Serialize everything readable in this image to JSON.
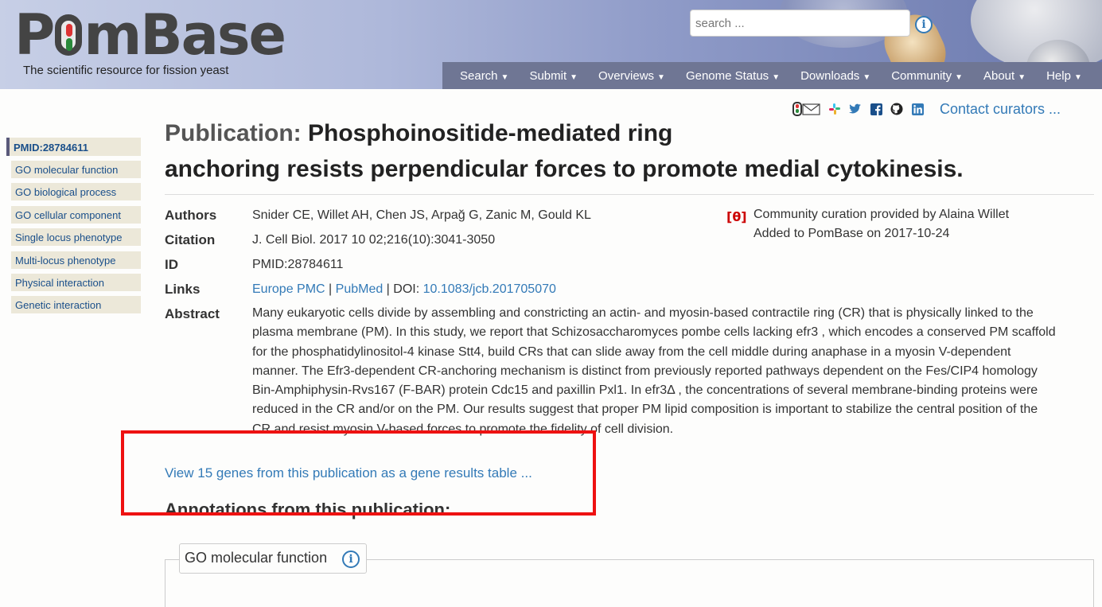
{
  "header": {
    "logo_text_left": "P",
    "logo_text_right": "mBase",
    "tagline": "The scientific resource for fission yeast",
    "search_placeholder": "search ...",
    "info_icon": "info-circle-icon",
    "nav": [
      "Search",
      "Submit",
      "Overviews",
      "Genome Status",
      "Downloads",
      "Community",
      "About",
      "Help"
    ]
  },
  "social": {
    "icons": [
      "pombase-mail-icon",
      "slack-icon",
      "twitter-icon",
      "facebook-icon",
      "github-icon",
      "linkedin-icon"
    ],
    "contact": "Contact curators ..."
  },
  "sidebar": {
    "title": "PMID:28784611",
    "items": [
      "GO molecular function",
      "GO biological process",
      "GO cellular component",
      "Single locus phenotype",
      "Multi-locus phenotype",
      "Physical interaction",
      "Genetic interaction"
    ]
  },
  "publication": {
    "title_label": "Publication: ",
    "title_line1": "Phosphoinositide-mediated ring",
    "title_line2": "anchoring resists perpendicular forces to promote medial cytokinesis.",
    "labels": {
      "authors": "Authors",
      "citation": "Citation",
      "id": "ID",
      "links": "Links",
      "abstract": "Abstract"
    },
    "authors": "Snider CE, Willet AH, Chen JS, Arpağ G, Zanic M, Gould KL",
    "citation": "J. Cell Biol. 2017 10 02;216(10):3041-3050",
    "id": "PMID:28784611",
    "links": {
      "europe_pmc": "Europe PMC",
      "sep1": " | ",
      "pubmed": "PubMed",
      "sep2": " | DOI: ",
      "doi": "10.1083/jcb.201705070"
    },
    "abstract": "Many eukaryotic cells divide by assembling and constricting an actin- and myosin-based contractile ring (CR) that is physically linked to the plasma membrane (PM). In this study, we report that Schizosaccharomyces pombe cells lacking efr3 , which encodes a conserved PM scaffold for the phosphatidylinositol-4 kinase Stt4, build CRs that can slide away from the cell middle during anaphase in a myosin V-dependent manner. The Efr3-dependent CR-anchoring mechanism is distinct from previously reported pathways dependent on the Fes/CIP4 homology Bin-Amphiphysin-Rvs167 (F-BAR) protein Cdc15 and paxillin Pxl1. In efr3Δ , the concentrations of several membrane-binding proteins were reduced in the CR and/or on the PM. Our results suggest that proper PM lipid composition is important to stabilize the central position of the CR and resist myosin V-based forces to promote the fidelity of cell division.",
    "curation_badge": "[θ]",
    "curation_line1": "Community curation provided by Alaina Willet",
    "curation_line2": "Added to PomBase on 2017-10-24"
  },
  "genes_link": "View 15 genes from this publication as a gene results table ...",
  "annotations_heading": "Annotations from this publication:",
  "panel_title": "GO molecular function",
  "colors": {
    "link": "#337ab7",
    "navbar": "#6f7694",
    "highlight": "#ee1111",
    "sidebar_bg": "#ece8d9"
  }
}
